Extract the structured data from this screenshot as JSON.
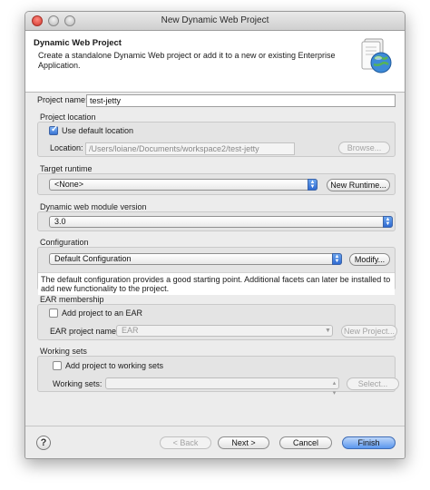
{
  "window": {
    "title": "New Dynamic Web Project"
  },
  "header": {
    "title": "Dynamic Web Project",
    "description": "Create a standalone Dynamic Web project or add it to a new or existing Enterprise Application.",
    "icon": "web-project-globe-icon"
  },
  "project_name": {
    "label": "Project name:",
    "value": "test-jetty"
  },
  "project_location": {
    "group_label": "Project location",
    "use_default_label": "Use default location",
    "use_default_checked": true,
    "location_label": "Location:",
    "location_value": "/Users/loiane/Documents/workspace2/test-jetty",
    "browse_label": "Browse..."
  },
  "target_runtime": {
    "group_label": "Target runtime",
    "selected": "<None>",
    "new_runtime_label": "New Runtime..."
  },
  "module_version": {
    "group_label": "Dynamic web module version",
    "selected": "3.0"
  },
  "configuration": {
    "group_label": "Configuration",
    "selected": "Default Configuration",
    "modify_label": "Modify...",
    "description": "The default configuration provides a good starting point. Additional facets can later be installed to add new functionality to the project."
  },
  "ear": {
    "group_label": "EAR membership",
    "add_label": "Add project to an EAR",
    "add_checked": false,
    "project_name_label": "EAR project name:",
    "project_name_value": "EAR",
    "new_project_label": "New Project..."
  },
  "working_sets": {
    "group_label": "Working sets",
    "add_label": "Add project to working sets",
    "add_checked": false,
    "sets_label": "Working sets:",
    "sets_value": "",
    "select_label": "Select..."
  },
  "footer": {
    "help_glyph": "?",
    "back_label": "< Back",
    "next_label": "Next >",
    "cancel_label": "Cancel",
    "finish_label": "Finish"
  },
  "colors": {
    "accent": "#3a74d4",
    "primary_button": "#5b97ee"
  }
}
